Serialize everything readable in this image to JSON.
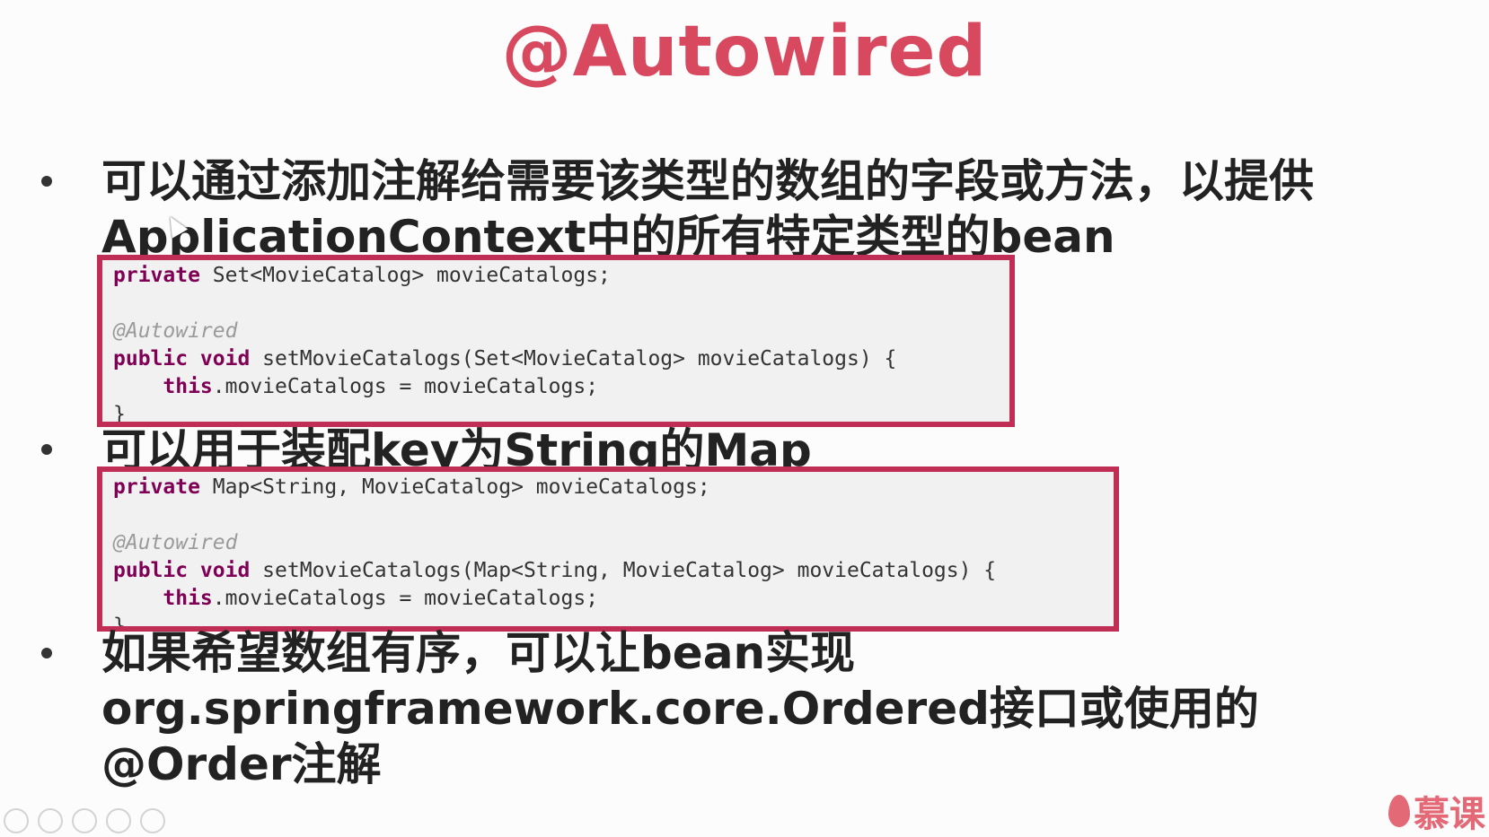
{
  "slide": {
    "title": "@Autowired",
    "bullets": [
      {
        "lines": [
          "可以通过添加注解给需要该类型的数组的字段或方法，以提供",
          "ApplicationContext中的所有特定类型的bean"
        ]
      },
      {
        "lines": [
          "可以用于装配key为String的Map"
        ]
      },
      {
        "lines": [
          "如果希望数组有序，可以让bean实现",
          "org.springframework.core.Ordered接口或使用的",
          "@Order注解"
        ]
      }
    ],
    "code_blocks": [
      {
        "line1": {
          "kw": "private",
          "rest": " Set<MovieCatalog> movieCatalogs;"
        },
        "line2": "",
        "line3": "@Autowired",
        "line4": {
          "kw": "public void",
          "rest": " setMovieCatalogs(Set<MovieCatalog> movieCatalogs) {"
        },
        "line5": {
          "indent": "    ",
          "kw": "this",
          "rest": ".movieCatalogs = movieCatalogs;"
        },
        "line6": "}"
      },
      {
        "line1": {
          "kw": "private",
          "rest": " Map<String, MovieCatalog> movieCatalogs;"
        },
        "line2": "",
        "line3": "@Autowired",
        "line4": {
          "kw": "public void",
          "rest": " setMovieCatalogs(Map<String, MovieCatalog> movieCatalogs) {"
        },
        "line5": {
          "indent": "    ",
          "kw": "this",
          "rest": ".movieCatalogs = movieCatalogs;"
        },
        "line6": "}"
      }
    ],
    "brand": "慕课"
  },
  "colors": {
    "title": "#d8485f",
    "code_border": "#c02d55",
    "keyword": "#7f0055",
    "annotation": "#9a9a9a"
  }
}
